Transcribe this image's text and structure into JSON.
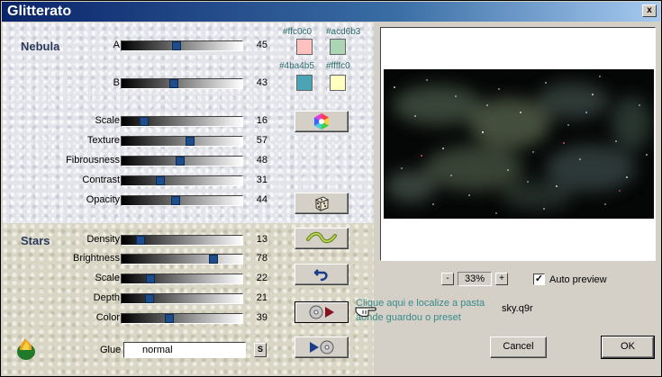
{
  "window": {
    "title": "Glitterato",
    "close_glyph": "x"
  },
  "nebula": {
    "label": "Nebula",
    "sliders": [
      {
        "label": "A",
        "value": 45
      },
      {
        "label": "B",
        "value": 43
      },
      {
        "label": "Scale",
        "value": 16
      },
      {
        "label": "Texture",
        "value": 57
      },
      {
        "label": "Fibrousness",
        "value": 48
      },
      {
        "label": "Contrast",
        "value": 31
      },
      {
        "label": "Opacity",
        "value": 44
      }
    ]
  },
  "stars": {
    "label": "Stars",
    "sliders": [
      {
        "label": "Density",
        "value": 13
      },
      {
        "label": "Brightness",
        "value": 78
      },
      {
        "label": "Scale",
        "value": 22
      },
      {
        "label": "Depth",
        "value": 21
      },
      {
        "label": "Color",
        "value": 39
      }
    ]
  },
  "slider_max": 100,
  "swatches": [
    {
      "label": "#ffc0c0",
      "color": "#ffc0c0"
    },
    {
      "label": "#acd6b3",
      "color": "#acd6b3"
    },
    {
      "label": "#4ba4b5",
      "color": "#4ba4b5"
    },
    {
      "label": "#ffffc0",
      "color": "#ffffc0"
    }
  ],
  "icons": {
    "color_wheel": "color-wheel-icon",
    "dice": "dice-icon",
    "wave": "wave-icon",
    "undo": "undo-icon",
    "load": "load-preset-icon",
    "save": "save-preset-icon",
    "hand": "pointing-hand-icon",
    "logo": "flame-logo-icon"
  },
  "zoom": {
    "minus": "-",
    "value": "33%",
    "plus": "+"
  },
  "auto_preview": {
    "label": "Auto preview",
    "checked": true,
    "check_glyph": "✓"
  },
  "hint": {
    "line1": "Clique aqui e localize a pasta",
    "line2": "aonde guardou o preset"
  },
  "preset_file": "sky.q9r",
  "glue": {
    "label": "Glue",
    "value": "normal",
    "s_button": "S"
  },
  "buttons": {
    "cancel": "Cancel",
    "ok": "OK"
  },
  "colors": {
    "accent": "#2b3a5a",
    "hint": "#3a8a8a",
    "slider_thumb": "#1e4d8c"
  }
}
